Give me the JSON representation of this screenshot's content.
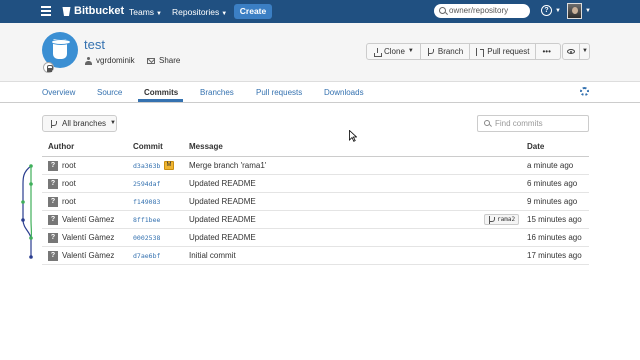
{
  "topnav": {
    "brand": "Bitbucket",
    "teams": "Teams",
    "repositories": "Repositories",
    "create": "Create",
    "search_placeholder": "owner/repository",
    "colors": {
      "bar": "#205081",
      "create_button": "#3b7fc4"
    }
  },
  "repo": {
    "name": "test",
    "owner": "vgrdominik",
    "share": "Share",
    "actions": [
      "Clone",
      "Branch",
      "Pull request",
      "•••"
    ]
  },
  "tabs": [
    "Overview",
    "Source",
    "Commits",
    "Branches",
    "Pull requests",
    "Downloads"
  ],
  "active_tab": "Commits",
  "toolbar": {
    "branch_filter": "All branches",
    "find_placeholder": "Find commits"
  },
  "table": {
    "headers": {
      "author": "Author",
      "commit": "Commit",
      "message": "Message",
      "date": "Date"
    },
    "rows": [
      {
        "avatar": "?",
        "author": "root",
        "hash": "d3a363b",
        "badge": "M",
        "message": "Merge branch 'rama1'",
        "tag": "",
        "date": "a minute ago"
      },
      {
        "avatar": "?",
        "author": "root",
        "hash": "2594daf",
        "badge": "",
        "message": "Updated README",
        "tag": "",
        "date": "6 minutes ago"
      },
      {
        "avatar": "?",
        "author": "root",
        "hash": "f149083",
        "badge": "",
        "message": "Updated README",
        "tag": "",
        "date": "9 minutes ago"
      },
      {
        "avatar": "?",
        "author": "Valentí Gàmez",
        "hash": "8ff1bee",
        "badge": "",
        "message": "Updated README",
        "tag": "rama2",
        "date": "15 minutes ago"
      },
      {
        "avatar": "?",
        "author": "Valentí Gàmez",
        "hash": "0002538",
        "badge": "",
        "message": "Updated README",
        "tag": "",
        "date": "16 minutes ago"
      },
      {
        "avatar": "?",
        "author": "Valentí Gàmez",
        "hash": "d7ae6bf",
        "badge": "",
        "message": "Initial commit",
        "tag": "",
        "date": "17 minutes ago"
      }
    ]
  },
  "graph_colors": {
    "main": "#2a3d8f",
    "branch": "#3faf5a"
  }
}
